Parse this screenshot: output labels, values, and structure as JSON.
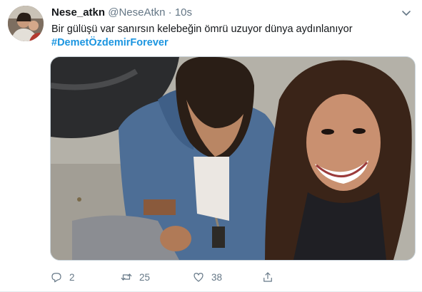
{
  "tweet": {
    "display_name": "Nese_atkn",
    "handle": "@NeseAtkn",
    "separator": "·",
    "timestamp": "10s",
    "text": "Bir gülüşü var sanırsın kelebeğin ömrü uzuyor dünya aydınlanıyor",
    "hashtag": "#DemetÖzdemirForever",
    "reply_count": "2",
    "retweet_count": "25",
    "like_count": "38",
    "link_color": "#1b95e0",
    "muted_color": "#657786"
  },
  "icons": {
    "more": "chevron-down-icon",
    "reply": "reply-icon",
    "retweet": "retweet-icon",
    "like": "heart-icon",
    "share": "share-icon"
  }
}
